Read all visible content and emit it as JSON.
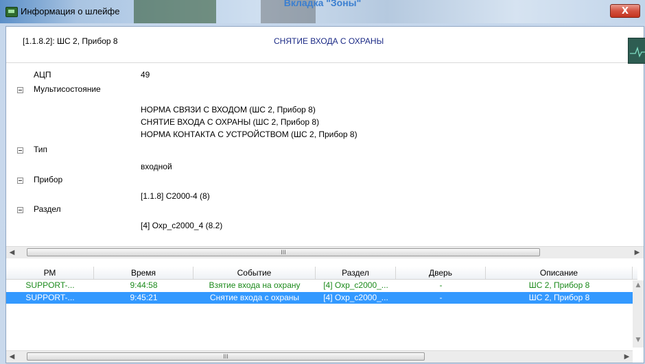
{
  "banner": "Вкладка \"Зоны\"",
  "window": {
    "title": "Информация о шлейфе",
    "close_label": "X"
  },
  "header": {
    "id": "[1.1.8.2]: ШС 2, Прибор 8",
    "event": "СНЯТИЕ ВХОДА С ОХРАНЫ"
  },
  "tree": {
    "adc_label": "АЦП",
    "adc_value": "49",
    "multistate_label": "Мультисостояние",
    "multistate_items": [
      "НОРМА СВЯЗИ С ВХОДОМ (ШС 2, Прибор 8)",
      "СНЯТИЕ ВХОДА С ОХРАНЫ (ШС 2, Прибор 8)",
      "НОРМА КОНТАКТА С УСТРОЙСТВОМ (ШС 2, Прибор 8)"
    ],
    "type_label": "Тип",
    "type_value": "входной",
    "device_label": "Прибор",
    "device_value": "[1.1.8] С2000-4 (8)",
    "partition_label": "Раздел",
    "partition_value": "[4] Охр_с2000_4 (8.2)"
  },
  "scroll_grip": "III",
  "table": {
    "columns": [
      "РМ",
      "Время",
      "Событие",
      "Раздел",
      "Дверь",
      "Описание"
    ],
    "rows": [
      [
        "SUPPORT-...",
        "9:44:58",
        "Взятие входа на охрану",
        "[4] Охр_с2000_...",
        "-",
        "ШС 2, Прибор 8"
      ],
      [
        "SUPPORT-...",
        "9:45:21",
        "Снятие входа с охраны",
        "[4] Охр_с2000_...",
        "-",
        "ШС 2, Прибор 8"
      ]
    ],
    "selected_row": 1
  },
  "colors": {
    "selection": "#3399ff",
    "normal_row_text": "#1b8a1b",
    "event_header": "#1b2a86",
    "close_button": "#c3341f"
  },
  "icons": [
    "monitor-icon",
    "close-icon",
    "collapse-icon",
    "graph-icon",
    "arrow-left-icon",
    "arrow-right-icon",
    "arrow-up-icon",
    "arrow-down-icon"
  ]
}
